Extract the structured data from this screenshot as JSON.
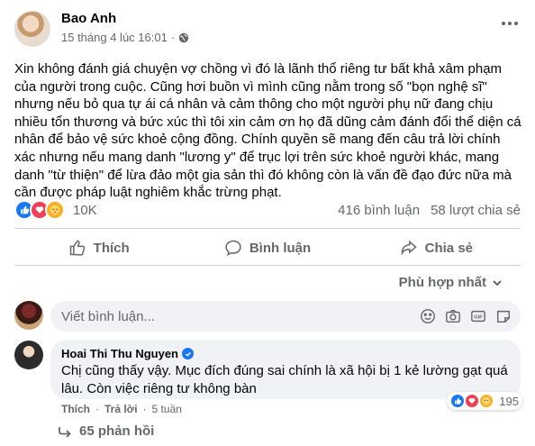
{
  "post": {
    "author": "Bao Anh",
    "timestamp": "15 tháng 4 lúc 16:01",
    "dot": "·",
    "text": "Xin không đánh giá chuyện vợ chồng vì đó là lãnh thổ riêng tư bất khả xâm phạm của người trong cuộc. Cũng hơi buồn vì mình cũng nằm trong số \"bọn nghệ sĩ\" nhưng nếu bỏ qua tự ái cá nhân và cảm thông cho một người phụ nữ đang chịu nhiều tổn thương và bức xúc thì tôi xin cảm ơn họ đã dũng cảm đánh đổi thể diện cá nhân để bảo vệ sức khoẻ cộng đồng. Chính quyền sẽ mang đến câu trả lời chính xác nhưng nếu mang danh \"lương y\" để trục lợi trên sức khoẻ người khác, mang danh \"từ thiện\" để lừa đảo một gia sản thì đó không còn là vấn đề đạo đức nữa mà cần được pháp luật nghiêm khắc trừng phạt.",
    "reaction_count": "10K",
    "comments_count": "416 bình luận",
    "shares_count": "58 lượt chia sẻ"
  },
  "actions": {
    "like": "Thích",
    "comment": "Bình luận",
    "share": "Chia sẻ"
  },
  "sort": {
    "label": "Phù hợp nhất"
  },
  "composer": {
    "placeholder": "Viết bình luận..."
  },
  "comment": {
    "author": "Hoai Thi Thu Nguyen",
    "text": "Chị cũng thấy vậy. Mục đích đúng sai chính là xã hội bị 1 kẻ lường gạt quá lâu. Còn việc riêng tư không bàn",
    "reaction_count": "195",
    "like": "Thích",
    "reply": "Trả lời",
    "sep": "·",
    "time": "5 tuần",
    "replies": "65 phản hồi"
  },
  "colors": {
    "accent": "#1877f2",
    "love": "#f33e58",
    "care": "#f7b125",
    "muted": "#65676b"
  },
  "icons": [
    "globe-icon",
    "more-icon",
    "like-icon",
    "comment-icon",
    "share-icon",
    "chevron-down-icon",
    "emoji-icon",
    "camera-icon",
    "gif-icon",
    "sticker-icon",
    "verified-icon",
    "reply-arrow-icon"
  ]
}
